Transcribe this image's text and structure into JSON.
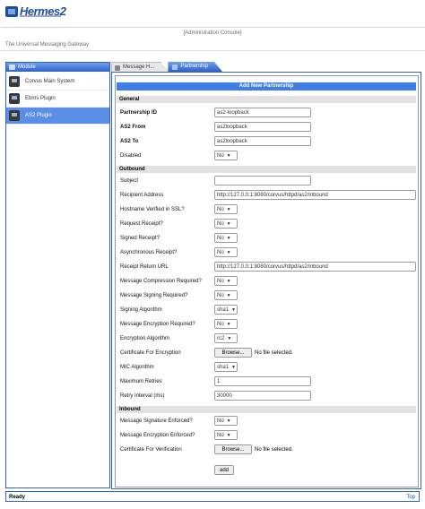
{
  "brand": {
    "name": "Hermes2"
  },
  "header": {
    "console_link": "[Administration Console]",
    "tagline": "The Universal Messaging Gateway"
  },
  "left_panel": {
    "tab_label": "Module",
    "items": [
      {
        "label": "Corvus Main System",
        "icon": "computer-icon",
        "active": false
      },
      {
        "label": "Ebms Plugin",
        "icon": "computer-icon",
        "active": false
      },
      {
        "label": "AS2 Plugin",
        "icon": "computer-icon",
        "active": true
      }
    ]
  },
  "tabs": [
    {
      "label": "Message H...",
      "active": false
    },
    {
      "label": "Partnership",
      "active": true
    }
  ],
  "form": {
    "title": "Add New Partnership",
    "general": {
      "section": "General",
      "partnership_id": {
        "label": "Partnership ID",
        "value": "as2-loopback"
      },
      "as2_from": {
        "label": "AS2 From",
        "value": "as2loopback"
      },
      "as2_to": {
        "label": "AS2 To",
        "value": "as2loopback"
      },
      "disabled": {
        "label": "Disabled",
        "value": "No"
      }
    },
    "outbound": {
      "section": "Outbound",
      "subject": {
        "label": "Subject",
        "value": ""
      },
      "recipient_address": {
        "label": "Recipient Address",
        "value": "http://127.0.0.1:8080/corvus/httpd/as2/inbound"
      },
      "hostname_verified": {
        "label": "Hostname Verified in SSL?",
        "value": "No"
      },
      "request_receipt": {
        "label": "Request Receipt?",
        "value": "No"
      },
      "signed_receipt": {
        "label": "Signed Receipt?",
        "value": "No"
      },
      "async_receipt": {
        "label": "Asynchronous Receipt?",
        "value": "No"
      },
      "receipt_return_url": {
        "label": "Receipt Return URL",
        "value": "http://127.0.0.1:8080/corvus/httpd/as2/inbound"
      },
      "compression_required": {
        "label": "Message Compression Required?",
        "value": "No"
      },
      "signing_required": {
        "label": "Message Signing Required?",
        "value": "No"
      },
      "signing_algorithm": {
        "label": "Signing Algorithm",
        "value": "sha1"
      },
      "encryption_required": {
        "label": "Message Encryption Required?",
        "value": "No"
      },
      "encryption_algorithm": {
        "label": "Encryption Algorithm",
        "value": "rc2"
      },
      "cert_encryption": {
        "label": "Certificate For Encryption",
        "button": "Browse...",
        "file_text": "No file selected."
      },
      "mic_algorithm": {
        "label": "MIC Algorithm",
        "value": "sha1"
      },
      "maximum_retries": {
        "label": "Maximum Retries",
        "value": "1"
      },
      "retry_interval": {
        "label": "Retry Interval (ms)",
        "value": "30000"
      }
    },
    "inbound": {
      "section": "Inbound",
      "signature_enforced": {
        "label": "Message Signature Enforced?",
        "value": "No"
      },
      "encryption_enforced": {
        "label": "Message Encryption Enforced?",
        "value": "No"
      },
      "cert_verification": {
        "label": "Certificate For Verification",
        "button": "Browse...",
        "file_text": "No file selected."
      }
    },
    "add_button": "add"
  },
  "status_bar": {
    "status": "Ready",
    "top_link": "Top"
  }
}
